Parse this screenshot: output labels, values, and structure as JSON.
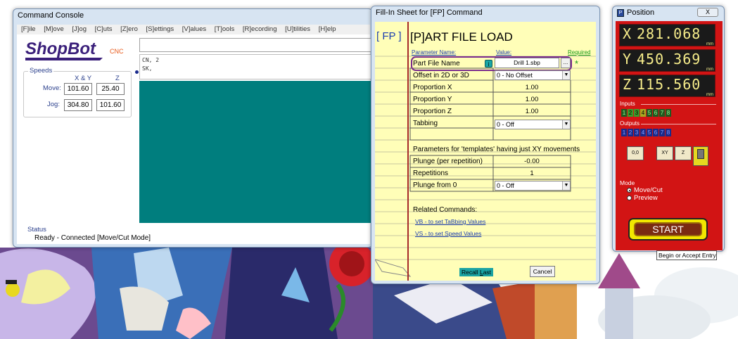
{
  "console": {
    "title": "Command Console",
    "menu": [
      "[F]ile",
      "[M]ove",
      "[J]og",
      "[C]uts",
      "[Z]ero",
      "[S]ettings",
      "[V]alues",
      "[T]ools",
      "[R]ecording",
      "[U]tilities",
      "[H]elp"
    ],
    "logo": "ShopBot",
    "logo_suffix": "CNC",
    "speeds": {
      "legend": "Speeds",
      "col_xy": "X & Y",
      "col_z": "Z",
      "move_label": "Move:",
      "jog_label": "Jog:",
      "move_xy": "101.60",
      "move_z": "25.40",
      "jog_xy": "304.80",
      "jog_z": "101.60"
    },
    "command_input": "",
    "log": [
      "CN, 2",
      "SK,"
    ],
    "status_legend": "Status",
    "status_text": "Ready - Connected  [Move/Cut Mode]"
  },
  "fillin": {
    "title": "Fill-In Sheet for [FP] Command",
    "code": "[ FP  ]",
    "heading": "[P]ART FILE LOAD",
    "col_param": "Parameter Name:",
    "col_value": "Value:",
    "col_required": "Required",
    "rows": [
      {
        "label": "Part File Name",
        "value": "Drill 1.sbp"
      },
      {
        "label": "Offset in 2D or 3D",
        "value": "0 - No Offset"
      },
      {
        "label": "Proportion X",
        "value": "1.00"
      },
      {
        "label": "Proportion Y",
        "value": "1.00"
      },
      {
        "label": "Proportion Z",
        "value": "1.00"
      },
      {
        "label": "Tabbing",
        "value": "0 - Off"
      },
      {
        "label": "Plunge (per repetition)",
        "value": "-0.00"
      },
      {
        "label": "Repetitions",
        "value": "1"
      },
      {
        "label": "Plunge from 0",
        "value": "0 - Off"
      }
    ],
    "browse_label": "...",
    "help_icon": "i",
    "required_mark": "*",
    "templates_note": "Parameters for 'templates' having just XY movements",
    "related_heading": "Related Commands:",
    "links": [
      "VB - to set TaBbing Values",
      "VS - to set Speed Values"
    ],
    "recall_pre": "Recall ",
    "recall_u": "L",
    "recall_post": "ast",
    "cancel_label": "Cancel"
  },
  "position": {
    "title": "Position",
    "close_label": "X",
    "axes": [
      {
        "axis": "X",
        "value": "281.068",
        "unit": "mm"
      },
      {
        "axis": "Y",
        "value": "450.369",
        "unit": "mm"
      },
      {
        "axis": "Z",
        "value": "115.560",
        "unit": "mm"
      }
    ],
    "inputs_label": "Inputs",
    "inputs": [
      "1",
      "2",
      "3",
      "4",
      "5",
      "6",
      "7",
      "8"
    ],
    "outputs_label": "Outputs",
    "outputs": [
      "1",
      "2",
      "3",
      "4",
      "5",
      "6",
      "7",
      "8"
    ],
    "tools": [
      "0,0",
      "XY",
      "Z",
      ""
    ],
    "mode_label": "Mode",
    "mode_options": [
      "Move/Cut",
      "Preview"
    ],
    "start_label": "START",
    "tooltip": "Begin or Accept Entry"
  },
  "colors": {
    "teal": "#007e7e",
    "position_red": "#d21414",
    "sheet_yellow": "#fffeb8",
    "link_blue": "#1c3fb0",
    "lcd_text": "#f6ec8a"
  }
}
